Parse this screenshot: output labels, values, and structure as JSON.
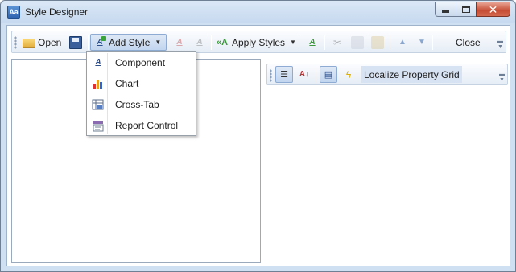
{
  "window": {
    "title": "Style Designer"
  },
  "toolbar": {
    "open_label": "Open",
    "add_style_label": "Add Style",
    "apply_styles_label": "Apply Styles",
    "close_label": "Close"
  },
  "add_style_menu": {
    "items": [
      {
        "label": "Component",
        "icon": "component-style-icon"
      },
      {
        "label": "Chart",
        "icon": "chart-style-icon"
      },
      {
        "label": "Cross-Tab",
        "icon": "cross-tab-style-icon"
      },
      {
        "label": "Report Control",
        "icon": "report-control-style-icon"
      }
    ]
  },
  "property_grid": {
    "localize_label": "Localize Property Grid"
  },
  "colors": {
    "accent": "#c2d6ef",
    "border": "#8eacd3",
    "close_red": "#c64d35"
  }
}
